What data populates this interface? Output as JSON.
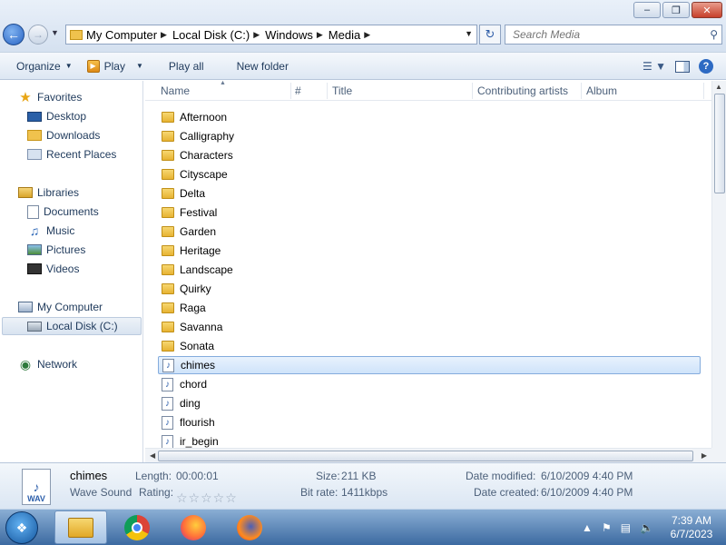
{
  "window": {
    "minimize": "–",
    "maximize": "❐",
    "close": "✕"
  },
  "address": {
    "crumbs": [
      "My Computer",
      "Local Disk (C:)",
      "Windows",
      "Media"
    ],
    "search_placeholder": "Search Media"
  },
  "toolbar": {
    "organize": "Organize",
    "play": "Play",
    "play_all": "Play all",
    "new_folder": "New folder"
  },
  "sidebar": {
    "favorites": "Favorites",
    "desktop": "Desktop",
    "downloads": "Downloads",
    "recent_places": "Recent Places",
    "libraries": "Libraries",
    "documents": "Documents",
    "music": "Music",
    "pictures": "Pictures",
    "videos": "Videos",
    "my_computer": "My Computer",
    "local_disk": "Local Disk (C:)",
    "network": "Network"
  },
  "columns": {
    "name": "Name",
    "number": "#",
    "title": "Title",
    "artists": "Contributing artists",
    "album": "Album"
  },
  "files": [
    {
      "name": "Afternoon",
      "type": "folder"
    },
    {
      "name": "Calligraphy",
      "type": "folder"
    },
    {
      "name": "Characters",
      "type": "folder"
    },
    {
      "name": "Cityscape",
      "type": "folder"
    },
    {
      "name": "Delta",
      "type": "folder"
    },
    {
      "name": "Festival",
      "type": "folder"
    },
    {
      "name": "Garden",
      "type": "folder"
    },
    {
      "name": "Heritage",
      "type": "folder"
    },
    {
      "name": "Landscape",
      "type": "folder"
    },
    {
      "name": "Quirky",
      "type": "folder"
    },
    {
      "name": "Raga",
      "type": "folder"
    },
    {
      "name": "Savanna",
      "type": "folder"
    },
    {
      "name": "Sonata",
      "type": "folder"
    },
    {
      "name": "chimes",
      "type": "audio",
      "selected": true
    },
    {
      "name": "chord",
      "type": "audio"
    },
    {
      "name": "ding",
      "type": "audio"
    },
    {
      "name": "flourish",
      "type": "midi"
    },
    {
      "name": "ir_begin",
      "type": "audio"
    }
  ],
  "details": {
    "name": "chimes",
    "type": "Wave Sound",
    "icon_label": "WAV",
    "length_label": "Length:",
    "length_value": "00:00:01",
    "rating_label": "Rating:",
    "rating_stars": "☆☆☆☆☆",
    "size_label": "Size:",
    "size_value": "211 KB",
    "bitrate_label": "Bit rate:",
    "bitrate_value": "1411kbps",
    "modified_label": "Date modified:",
    "modified_value": "6/10/2009 4:40 PM",
    "created_label": "Date created:",
    "created_value": "6/10/2009 4:40 PM"
  },
  "taskbar": {
    "time": "7:39 AM",
    "date": "6/7/2023"
  },
  "colors": {
    "accent": "#2d6ac3",
    "selection": "#cfe3fa",
    "close_button": "#c7402b"
  }
}
